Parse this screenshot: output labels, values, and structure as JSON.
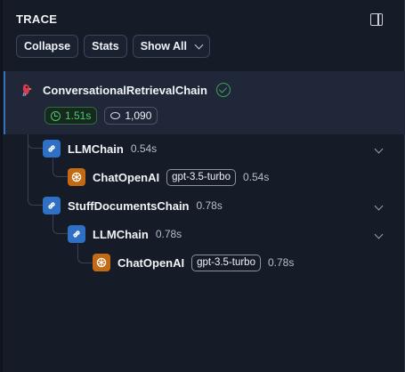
{
  "header": {
    "title": "TRACE",
    "toggle_icon": "sidebar-panel-icon"
  },
  "toolbar": {
    "collapse_label": "Collapse",
    "stats_label": "Stats",
    "show_all_label": "Show All"
  },
  "root": {
    "name": "ConversationalRetrievalChain",
    "icon": "parrot-icon",
    "status_icon": "check-circle-icon",
    "latency": "1.51s",
    "tokens": "1,090"
  },
  "runs": [
    {
      "name": "LLMChain",
      "duration": "0.54s",
      "icon": "chain-link-icon",
      "expand_icon": "chevron-down-icon"
    },
    {
      "name": "ChatOpenAI",
      "model": "gpt-3.5-turbo",
      "duration": "0.54s",
      "icon": "openai-icon"
    },
    {
      "name": "StuffDocumentsChain",
      "duration": "0.78s",
      "icon": "chain-link-icon",
      "expand_icon": "chevron-down-icon"
    },
    {
      "name": "LLMChain",
      "duration": "0.78s",
      "icon": "chain-link-icon",
      "expand_icon": "chevron-down-icon"
    },
    {
      "name": "ChatOpenAI",
      "model": "gpt-3.5-turbo",
      "duration": "0.78s",
      "icon": "openai-icon"
    }
  ],
  "colors": {
    "chain_icon_bg": "#2f6fc4",
    "openai_icon_bg": "#c36a13",
    "success": "#4ccb6c",
    "selected_bg": "#1f2738"
  }
}
